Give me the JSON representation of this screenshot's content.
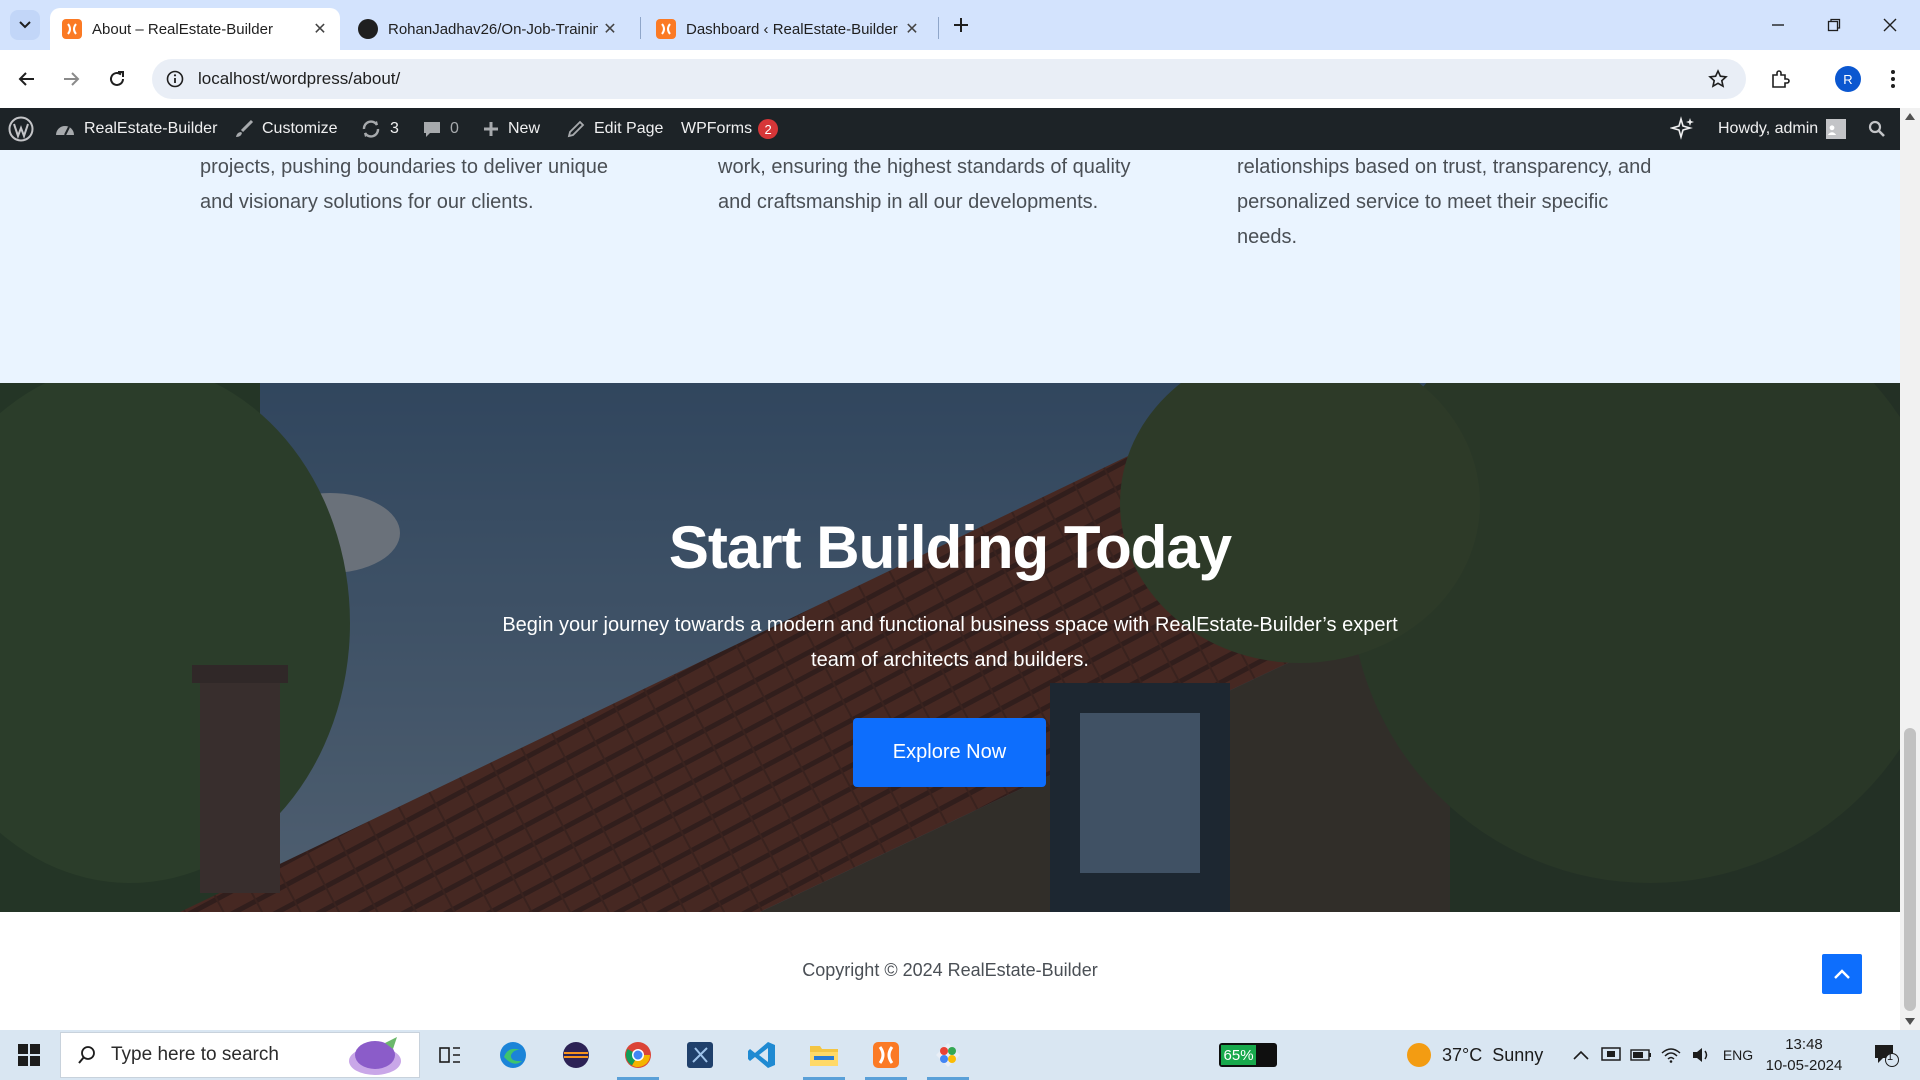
{
  "browser": {
    "tabs": [
      {
        "title": "About – RealEstate-Builder",
        "active": true,
        "icon": "xampp-icon"
      },
      {
        "title": "RohanJadhav26/On-Job-Trainin",
        "active": false,
        "icon": "github-icon"
      },
      {
        "title": "Dashboard ‹ RealEstate-Builder",
        "active": false,
        "icon": "xampp-icon"
      }
    ],
    "url": "localhost/wordpress/about/",
    "profile_initial": "R"
  },
  "adminbar": {
    "site_name": "RealEstate-Builder",
    "customize": "Customize",
    "updates_count": "3",
    "comments_count": "0",
    "new_label": "New",
    "edit_page": "Edit Page",
    "wpforms": "WPForms",
    "wpforms_badge": "2",
    "howdy": "Howdy, admin"
  },
  "values_section": {
    "columns": [
      [
        "projects, pushing boundaries to deliver unique",
        "and visionary solutions for our clients."
      ],
      [
        "work, ensuring the highest standards of quality",
        "and craftsmanship in all our developments."
      ],
      [
        "relationships based on trust, transparency, and",
        "personalized service to meet their specific",
        "needs."
      ]
    ]
  },
  "cta": {
    "title": "Start Building Today",
    "text_line1": "Begin your journey towards a modern and functional business space with RealEstate-Builder’s expert",
    "text_line2": "team of architects and builders.",
    "button": "Explore Now"
  },
  "footer": {
    "copyright": "Copyright © 2024 RealEstate-Builder"
  },
  "taskbar": {
    "search_placeholder": "Type here to search",
    "battery_widget": "65%",
    "battery_level": 0.65,
    "weather_temp": "37°C",
    "weather_desc": "Sunny",
    "language": "ENG",
    "time": "13:48",
    "date": "10-05-2024",
    "notification_count": "1"
  },
  "colors": {
    "accent": "#0d6efd",
    "adminbar": "#1d2327",
    "values_bg": "#eaf4ff",
    "tabstrip": "#d3e3fd"
  }
}
